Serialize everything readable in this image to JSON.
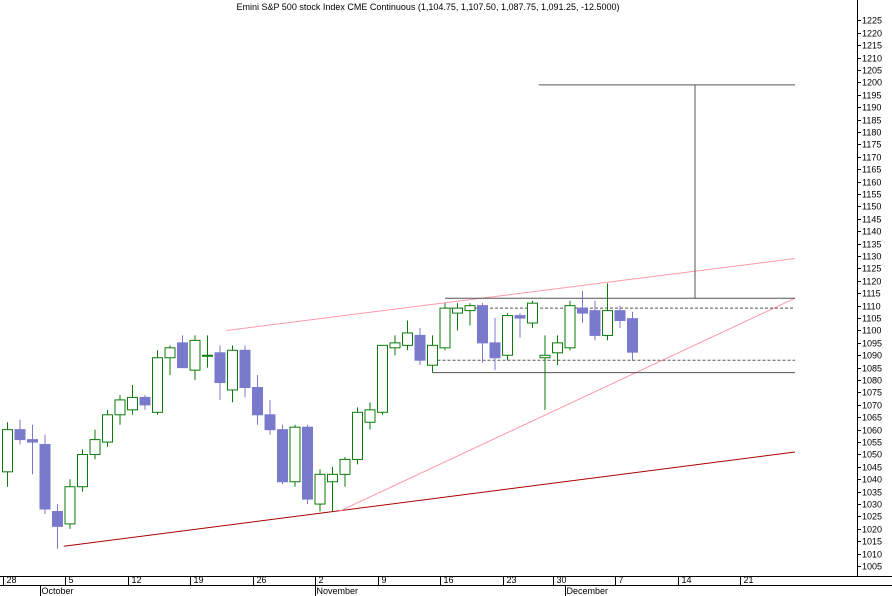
{
  "chart_data": {
    "type": "candlestick",
    "title": "Emini S&P 500 stock Index CME Continuous (1,104.75, 1,107.50, 1,087.75, 1,091.25, -12.5000)",
    "ylim": [
      1001,
      1228
    ],
    "y_ticks": [
      1005,
      1010,
      1015,
      1020,
      1025,
      1030,
      1035,
      1040,
      1045,
      1050,
      1055,
      1060,
      1065,
      1070,
      1075,
      1080,
      1085,
      1090,
      1095,
      1100,
      1105,
      1110,
      1115,
      1120,
      1125,
      1130,
      1135,
      1140,
      1145,
      1150,
      1155,
      1160,
      1165,
      1170,
      1175,
      1180,
      1185,
      1190,
      1195,
      1200,
      1205,
      1210,
      1215,
      1220,
      1225
    ],
    "x_day_labels": [
      {
        "label": "28",
        "bar": 0
      },
      {
        "label": "5",
        "bar": 5
      },
      {
        "label": "12",
        "bar": 10
      },
      {
        "label": "19",
        "bar": 15
      },
      {
        "label": "26",
        "bar": 20
      },
      {
        "label": "2",
        "bar": 25
      },
      {
        "label": "9",
        "bar": 30
      },
      {
        "label": "16",
        "bar": 35
      },
      {
        "label": "23",
        "bar": 40
      },
      {
        "label": "30",
        "bar": 44
      },
      {
        "label": "7",
        "bar": 49
      },
      {
        "label": "14",
        "bar": 54
      },
      {
        "label": "21",
        "bar": 59
      }
    ],
    "x_month_labels": [
      {
        "label": "October",
        "bar": 3
      },
      {
        "label": "November",
        "bar": 25
      },
      {
        "label": "December",
        "bar": 45
      }
    ],
    "ohlc": [
      {
        "o": 1043,
        "h": 1063,
        "l": 1037,
        "c": 1060
      },
      {
        "o": 1060,
        "h": 1064,
        "l": 1054,
        "c": 1056
      },
      {
        "o": 1056,
        "h": 1062,
        "l": 1042,
        "c": 1055
      },
      {
        "o": 1054,
        "h": 1058,
        "l": 1026,
        "c": 1028
      },
      {
        "o": 1027,
        "h": 1030,
        "l": 1012,
        "c": 1021
      },
      {
        "o": 1022,
        "h": 1040,
        "l": 1020,
        "c": 1037
      },
      {
        "o": 1037,
        "h": 1052,
        "l": 1035,
        "c": 1050
      },
      {
        "o": 1050,
        "h": 1060,
        "l": 1048,
        "c": 1056
      },
      {
        "o": 1055,
        "h": 1068,
        "l": 1053,
        "c": 1066
      },
      {
        "o": 1066,
        "h": 1074,
        "l": 1062,
        "c": 1072
      },
      {
        "o": 1068,
        "h": 1078,
        "l": 1066,
        "c": 1073
      },
      {
        "o": 1073,
        "h": 1074,
        "l": 1068,
        "c": 1070
      },
      {
        "o": 1067,
        "h": 1092,
        "l": 1066,
        "c": 1089
      },
      {
        "o": 1089,
        "h": 1094,
        "l": 1082,
        "c": 1093
      },
      {
        "o": 1095,
        "h": 1098,
        "l": 1085,
        "c": 1085
      },
      {
        "o": 1084,
        "h": 1098,
        "l": 1080,
        "c": 1096
      },
      {
        "o": 1090,
        "h": 1098,
        "l": 1085,
        "c": 1090
      },
      {
        "o": 1091,
        "h": 1094,
        "l": 1072,
        "c": 1079
      },
      {
        "o": 1076,
        "h": 1094,
        "l": 1071,
        "c": 1092
      },
      {
        "o": 1092,
        "h": 1094,
        "l": 1073,
        "c": 1077
      },
      {
        "o": 1077,
        "h": 1082,
        "l": 1062,
        "c": 1066
      },
      {
        "o": 1066,
        "h": 1072,
        "l": 1058,
        "c": 1060
      },
      {
        "o": 1060,
        "h": 1062,
        "l": 1038,
        "c": 1039
      },
      {
        "o": 1039,
        "h": 1062,
        "l": 1037,
        "c": 1061
      },
      {
        "o": 1061,
        "h": 1062,
        "l": 1030,
        "c": 1032
      },
      {
        "o": 1030,
        "h": 1044,
        "l": 1027,
        "c": 1042
      },
      {
        "o": 1039,
        "h": 1045,
        "l": 1027,
        "c": 1042
      },
      {
        "o": 1042,
        "h": 1049,
        "l": 1037,
        "c": 1048
      },
      {
        "o": 1048,
        "h": 1069,
        "l": 1046,
        "c": 1067
      },
      {
        "o": 1063,
        "h": 1071,
        "l": 1060,
        "c": 1068
      },
      {
        "o": 1067,
        "h": 1094,
        "l": 1066,
        "c": 1094
      },
      {
        "o": 1093,
        "h": 1098,
        "l": 1090,
        "c": 1095
      },
      {
        "o": 1094,
        "h": 1104,
        "l": 1092,
        "c": 1099
      },
      {
        "o": 1098,
        "h": 1101,
        "l": 1086,
        "c": 1088
      },
      {
        "o": 1086,
        "h": 1098,
        "l": 1083,
        "c": 1094
      },
      {
        "o": 1093,
        "h": 1111,
        "l": 1092,
        "c": 1109
      },
      {
        "o": 1107,
        "h": 1111,
        "l": 1100,
        "c": 1109
      },
      {
        "o": 1108,
        "h": 1111,
        "l": 1102,
        "c": 1110
      },
      {
        "o": 1110,
        "h": 1111,
        "l": 1087,
        "c": 1095
      },
      {
        "o": 1095,
        "h": 1105,
        "l": 1084,
        "c": 1089
      },
      {
        "o": 1090,
        "h": 1107,
        "l": 1088,
        "c": 1106
      },
      {
        "o": 1106,
        "h": 1107,
        "l": 1097,
        "c": 1105
      },
      {
        "o": 1103,
        "h": 1112,
        "l": 1101,
        "c": 1111
      },
      {
        "o": 1089,
        "h": 1098,
        "l": 1068,
        "c": 1090
      },
      {
        "o": 1091,
        "h": 1098,
        "l": 1086,
        "c": 1095
      },
      {
        "o": 1093,
        "h": 1112,
        "l": 1092,
        "c": 1110
      },
      {
        "o": 1109,
        "h": 1116,
        "l": 1103,
        "c": 1107
      },
      {
        "o": 1108,
        "h": 1112,
        "l": 1096,
        "c": 1098
      },
      {
        "o": 1098,
        "h": 1119,
        "l": 1096,
        "c": 1108
      },
      {
        "o": 1108,
        "h": 1110,
        "l": 1101,
        "c": 1104
      },
      {
        "o": 1104.75,
        "h": 1107.5,
        "l": 1087.75,
        "c": 1091.25
      }
    ],
    "bull_color": "#0a7a0a",
    "bear_color": "#7a7acc",
    "annotations": [
      {
        "name": "lower-red-trendline",
        "color": "#aa0000",
        "from": {
          "bar": 4.5,
          "y": 1013
        },
        "to": {
          "bar": 63,
          "y": 1051
        }
      },
      {
        "name": "upper-pink-trendline",
        "color": "#ff99aa",
        "from": {
          "bar": 17.5,
          "y": 1100
        },
        "to": {
          "bar": 63,
          "y": 1129
        }
      },
      {
        "name": "mid-pink-trendline",
        "color": "#ff99aa",
        "from": {
          "bar": 26.5,
          "y": 1027
        },
        "to": {
          "bar": 63,
          "y": 1113
        }
      },
      {
        "name": "resistance-hline",
        "color": "#555555",
        "from": {
          "bar": 35,
          "y": 1113
        },
        "to": {
          "bar": 63,
          "y": 1113
        }
      },
      {
        "name": "support-hline",
        "color": "#555555",
        "from": {
          "bar": 34,
          "y": 1083
        },
        "to": {
          "bar": 63,
          "y": 1083
        }
      },
      {
        "name": "dashed-upper-level",
        "color": "#555555",
        "dashed": true,
        "from": {
          "bar": 35,
          "y": 1109
        },
        "to": {
          "bar": 63,
          "y": 1109
        }
      },
      {
        "name": "dashed-lower-level",
        "color": "#555555",
        "dashed": true,
        "from": {
          "bar": 34,
          "y": 1088
        },
        "to": {
          "bar": 63,
          "y": 1088
        }
      },
      {
        "name": "target-hline",
        "color": "#555555",
        "from": {
          "bar": 42.5,
          "y": 1199
        },
        "to": {
          "bar": 63,
          "y": 1199
        }
      },
      {
        "name": "target-vline",
        "color": "#555555",
        "from": {
          "bar": 55,
          "y": 1199
        },
        "to": {
          "bar": 55,
          "y": 1113
        }
      },
      {
        "name": "box-left-edge",
        "color": "#555555",
        "from": {
          "bar": 34,
          "y": 1088
        },
        "to": {
          "bar": 34,
          "y": 1083
        }
      }
    ]
  }
}
